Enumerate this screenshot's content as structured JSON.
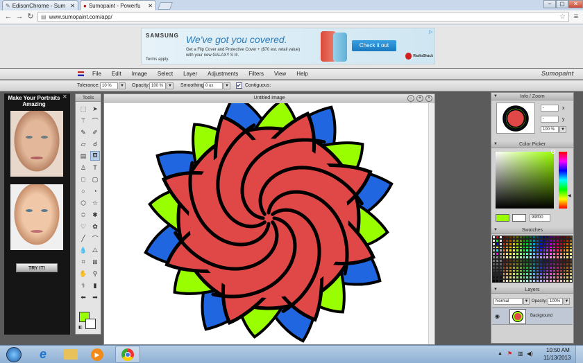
{
  "browser": {
    "tabs": [
      {
        "title": "EdisonChrome - Sum"
      },
      {
        "title": "Sumopaint - Powerfu"
      }
    ],
    "url": "www.sumopaint.com/app/"
  },
  "ad_top": {
    "brand": "SAMSUNG",
    "headline": "We've got you covered.",
    "line1": "Get a Flip Cover and Protective Cover + ($70 est. retail value)",
    "line2": "with your new GALAXY S III.",
    "cta": "Check it out",
    "terms": "Terms apply.",
    "partner": "RadioShack"
  },
  "menu": {
    "items": [
      "File",
      "Edit",
      "Image",
      "Select",
      "Layer",
      "Adjustments",
      "Filters",
      "View",
      "Help"
    ],
    "logo": "Sumopaint"
  },
  "options": {
    "tolerance_label": "Tolerance:",
    "tolerance_value": "10 %",
    "opacity_label": "Opacity:",
    "opacity_value": "100 %",
    "smoothing_label": "Smoothing:",
    "smoothing_value": "0 ox",
    "contiguous_label": "Contiguous:"
  },
  "ad_left": {
    "headline": "Make Your Portraits Amazing",
    "cta": "TRY IT!"
  },
  "tools": {
    "title": "Tools"
  },
  "canvas": {
    "title": "Untitled Image"
  },
  "info_panel": {
    "title": "Info / Zoom",
    "x_value": "-",
    "x_label": "x",
    "y_value": "-",
    "y_label": "y",
    "zoom_value": "100 %"
  },
  "color_picker": {
    "title": "Color Picker",
    "hex_value": "99ff00",
    "fg_color": "#99ff00",
    "bg_color": "#ffffff"
  },
  "swatches": {
    "title": "Swatches"
  },
  "layers": {
    "title": "Layers",
    "blend_mode": "Normal",
    "opacity_label": "Opacity:",
    "opacity_value": "100%",
    "layer_name": "Background"
  },
  "taskbar": {
    "time": "10:50 AM",
    "date": "11/13/2013"
  },
  "colors": {
    "flower_red": "#e04848",
    "flower_green": "#99ff00",
    "flower_blue": "#1f66e0",
    "outline": "#000000"
  }
}
